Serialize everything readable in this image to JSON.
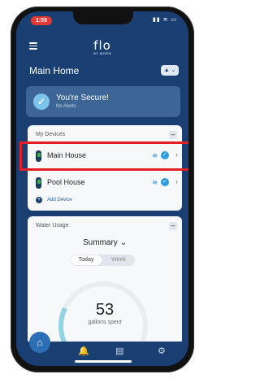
{
  "status_bar": {
    "time": "1:55",
    "indicators": "▮▮ ≋ ▭"
  },
  "header": {
    "logo": "flo",
    "logo_sub": "BY MOEN",
    "title": "Main Home",
    "home_button": "▲ ⌄"
  },
  "security": {
    "title": "You're Secure!",
    "subtitle": "No Alerts"
  },
  "devices": {
    "title": "My Devices",
    "collapse": "–",
    "items": [
      {
        "label": "Main House",
        "highlighted": true
      },
      {
        "label": "Pool House",
        "highlighted": false
      }
    ],
    "add_label": "Add Device"
  },
  "water_usage": {
    "title": "Water Usage",
    "collapse": "–",
    "view_label": "Summary ⌄",
    "toggle": {
      "today": "Today",
      "week": "Week",
      "selected": "Today"
    },
    "value": "53",
    "unit": "gallons spent"
  },
  "nav": {
    "home_icon": "⌂",
    "alerts_icon": "🔔",
    "chat_icon": "▤",
    "settings_icon": "⚙"
  },
  "colors": {
    "background": "#1a3f73",
    "highlight": "#e11f25",
    "accent": "#2e9be0"
  }
}
